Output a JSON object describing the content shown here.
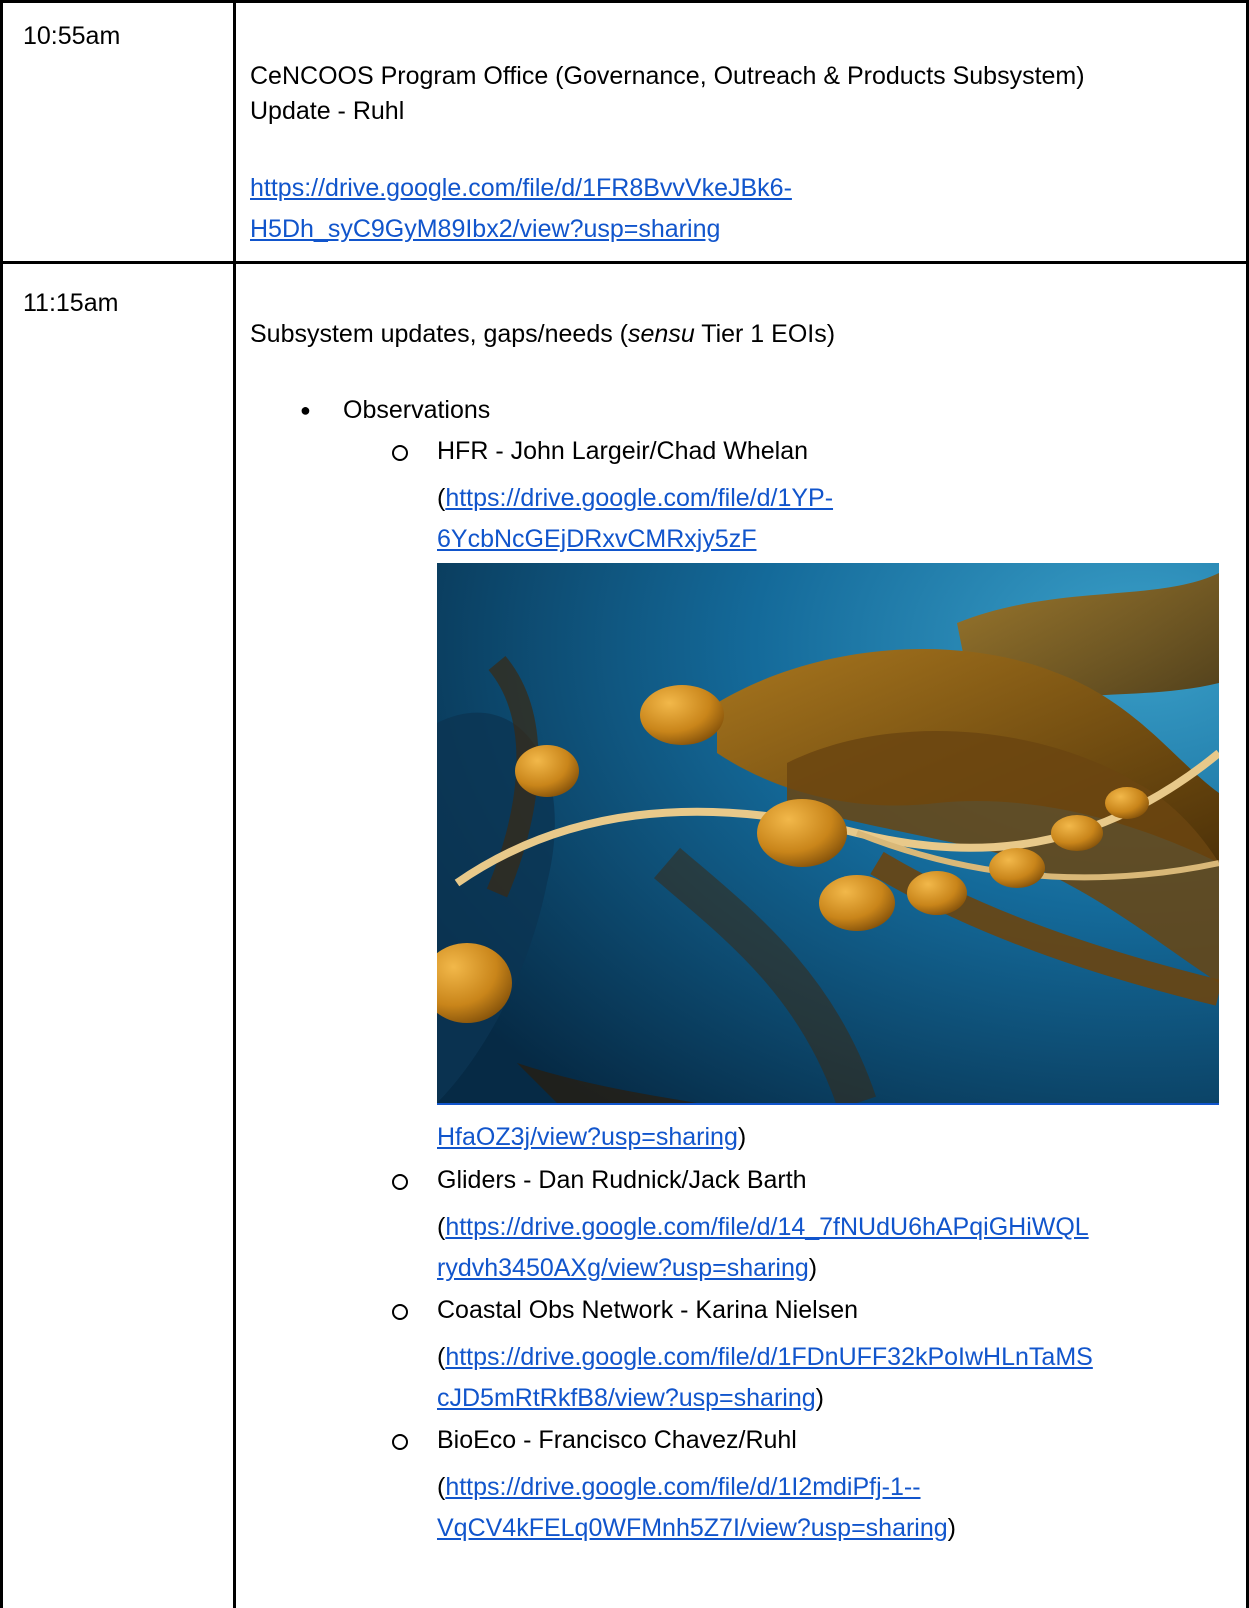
{
  "rows": [
    {
      "time": "10:55am",
      "title_line1": "CeNCOOS Program Office (Governance, Outreach & Products Subsystem)",
      "title_line2": "Update - Ruhl",
      "link_line1": "https://drive.google.com/file/d/1FR8BvvVkeJBk6-",
      "link_line2": "H5Dh_syC9GyM89Ibx2/view?usp=sharing"
    },
    {
      "time": "11:15am",
      "heading_pre": "Subsystem updates, gaps/needs (",
      "heading_em": "sensu",
      "heading_post": " Tier 1 EOIs)",
      "bullet_label": "Observations",
      "items": [
        {
          "label": "HFR - John Largeir/Chad Whelan",
          "link_line1": "https://drive.google.com/file/d/1YP-",
          "link_line2": "6YcbNcGEjDRxvCMRxjy5zF",
          "link_line3": "HfaOZ3j/view?usp=sharing"
        },
        {
          "label": "Gliders - Dan Rudnick/Jack Barth",
          "link_line1": "https://drive.google.com/file/d/14_7fNUdU6hAPqiGHiWQL",
          "link_line2": "rydvh3450AXg/view?usp=sharing"
        },
        {
          "label": "Coastal Obs Network - Karina Nielsen",
          "link_line1": "https://drive.google.com/file/d/1FDnUFF32kPoIwHLnTaMS",
          "link_line2": "cJD5mRtRkfB8/view?usp=sharing"
        },
        {
          "label": "BioEco - Francisco Chavez/Ruhl",
          "link_line1": "https://drive.google.com/file/d/1I2mdiPfj-1--",
          "link_line2": "VqCV4kFELq0WFMnh5Z7I/view?usp=sharing"
        }
      ]
    }
  ],
  "punct": {
    "open_paren": "(",
    "close_paren": ")"
  },
  "photo": {
    "icon": "kelp-underwater-photo"
  }
}
